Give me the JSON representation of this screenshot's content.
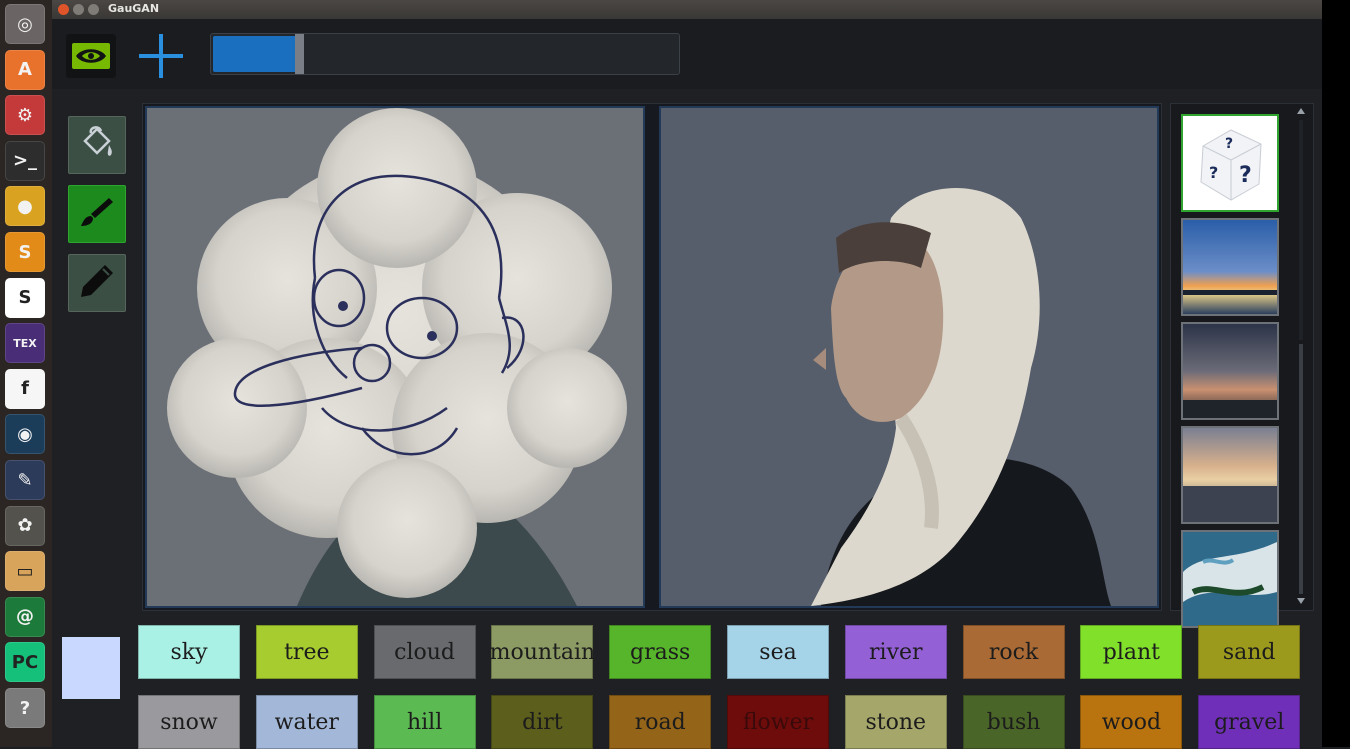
{
  "window": {
    "title": "GauGAN"
  },
  "launcher": {
    "items": [
      {
        "name": "ubuntu-home-icon",
        "color": "#6a6564",
        "glyph": "◎"
      },
      {
        "name": "software-center-icon",
        "color": "#e8722c",
        "glyph": "A"
      },
      {
        "name": "system-settings-icon",
        "color": "#c43a3a",
        "glyph": "⚙"
      },
      {
        "name": "terminal-icon",
        "color": "#2d2d2d",
        "glyph": ">_"
      },
      {
        "name": "chrome-icon",
        "color": "#d9a321",
        "glyph": "●"
      },
      {
        "name": "sublime-text-icon",
        "color": "#e28b18",
        "glyph": "S"
      },
      {
        "name": "slack-icon",
        "color": "#ffffff",
        "glyph": "S"
      },
      {
        "name": "texmaker-icon",
        "color": "#4a2d77",
        "glyph": "TEX"
      },
      {
        "name": "font-viewer-icon",
        "color": "#f6f6f6",
        "glyph": "f"
      },
      {
        "name": "globe-icon",
        "color": "#1b3d5a",
        "glyph": "◉"
      },
      {
        "name": "paint-icon",
        "color": "#2d3b5a",
        "glyph": "✎"
      },
      {
        "name": "gimp-icon",
        "color": "#53524c",
        "glyph": "✿"
      },
      {
        "name": "files-icon",
        "color": "#d8a35a",
        "glyph": "▭"
      },
      {
        "name": "ide-icon",
        "color": "#1c7a3a",
        "glyph": "@"
      },
      {
        "name": "pycharm-icon",
        "color": "#14c07a",
        "glyph": "PC"
      },
      {
        "name": "help-icon",
        "color": "#7a7a7a",
        "glyph": "?"
      }
    ]
  },
  "toolbar": {
    "plus_label": "+",
    "slider_level": 0.18
  },
  "tools": [
    {
      "name": "fill-bucket-tool",
      "bg": "#3b4f45",
      "active": false
    },
    {
      "name": "brush-tool",
      "bg": "#1c8a1c",
      "active": true
    },
    {
      "name": "pencil-tool",
      "bg": "#3b4f45",
      "active": false
    }
  ],
  "current_color": "#c8d8ff",
  "thumbnails": [
    {
      "name": "random-style-thumb",
      "kind": "dice"
    },
    {
      "name": "style-thumb-sunset-lake",
      "kind": "sunset"
    },
    {
      "name": "style-thumb-clouds-dusk",
      "kind": "dusk"
    },
    {
      "name": "style-thumb-city-clouds",
      "kind": "city"
    },
    {
      "name": "style-thumb-painting",
      "kind": "paint"
    }
  ],
  "palette": [
    {
      "label": "sky",
      "color": "#a9f0e5",
      "text": "#1c1c1c"
    },
    {
      "label": "tree",
      "color": "#a6cc2f",
      "text": "#1c1c1c"
    },
    {
      "label": "cloud",
      "color": "#686a6e",
      "text": "#1c1c1c"
    },
    {
      "label": "mountain",
      "color": "#8c9a63",
      "text": "#1c1c1c"
    },
    {
      "label": "grass",
      "color": "#56b52a",
      "text": "#1c1c1c"
    },
    {
      "label": "sea",
      "color": "#a5d3e8",
      "text": "#1c1c1c"
    },
    {
      "label": "river",
      "color": "#9460d6",
      "text": "#1c1c1c"
    },
    {
      "label": "rock",
      "color": "#a96a35",
      "text": "#1c1c1c"
    },
    {
      "label": "plant",
      "color": "#81e02a",
      "text": "#1c1c1c"
    },
    {
      "label": "sand",
      "color": "#9c9a1c",
      "text": "#1c1c1c"
    },
    {
      "label": "snow",
      "color": "#9a9a9e",
      "text": "#1c1c1c"
    },
    {
      "label": "water",
      "color": "#a3b8d8",
      "text": "#1c1c1c"
    },
    {
      "label": "hill",
      "color": "#5cba52",
      "text": "#1c1c1c"
    },
    {
      "label": "dirt",
      "color": "#5c5e1c",
      "text": "#1c1c1c"
    },
    {
      "label": "road",
      "color": "#946419",
      "text": "#1c1c1c"
    },
    {
      "label": "flower",
      "color": "#6e0c0c",
      "text": "#3a0a0a"
    },
    {
      "label": "stone",
      "color": "#a5a66a",
      "text": "#1c1c1c"
    },
    {
      "label": "bush",
      "color": "#4a6528",
      "text": "#1c1c1c"
    },
    {
      "label": "wood",
      "color": "#b9730f",
      "text": "#1c1c1c"
    },
    {
      "label": "gravel",
      "color": "#6f2fb9",
      "text": "#1c1c1c"
    }
  ]
}
